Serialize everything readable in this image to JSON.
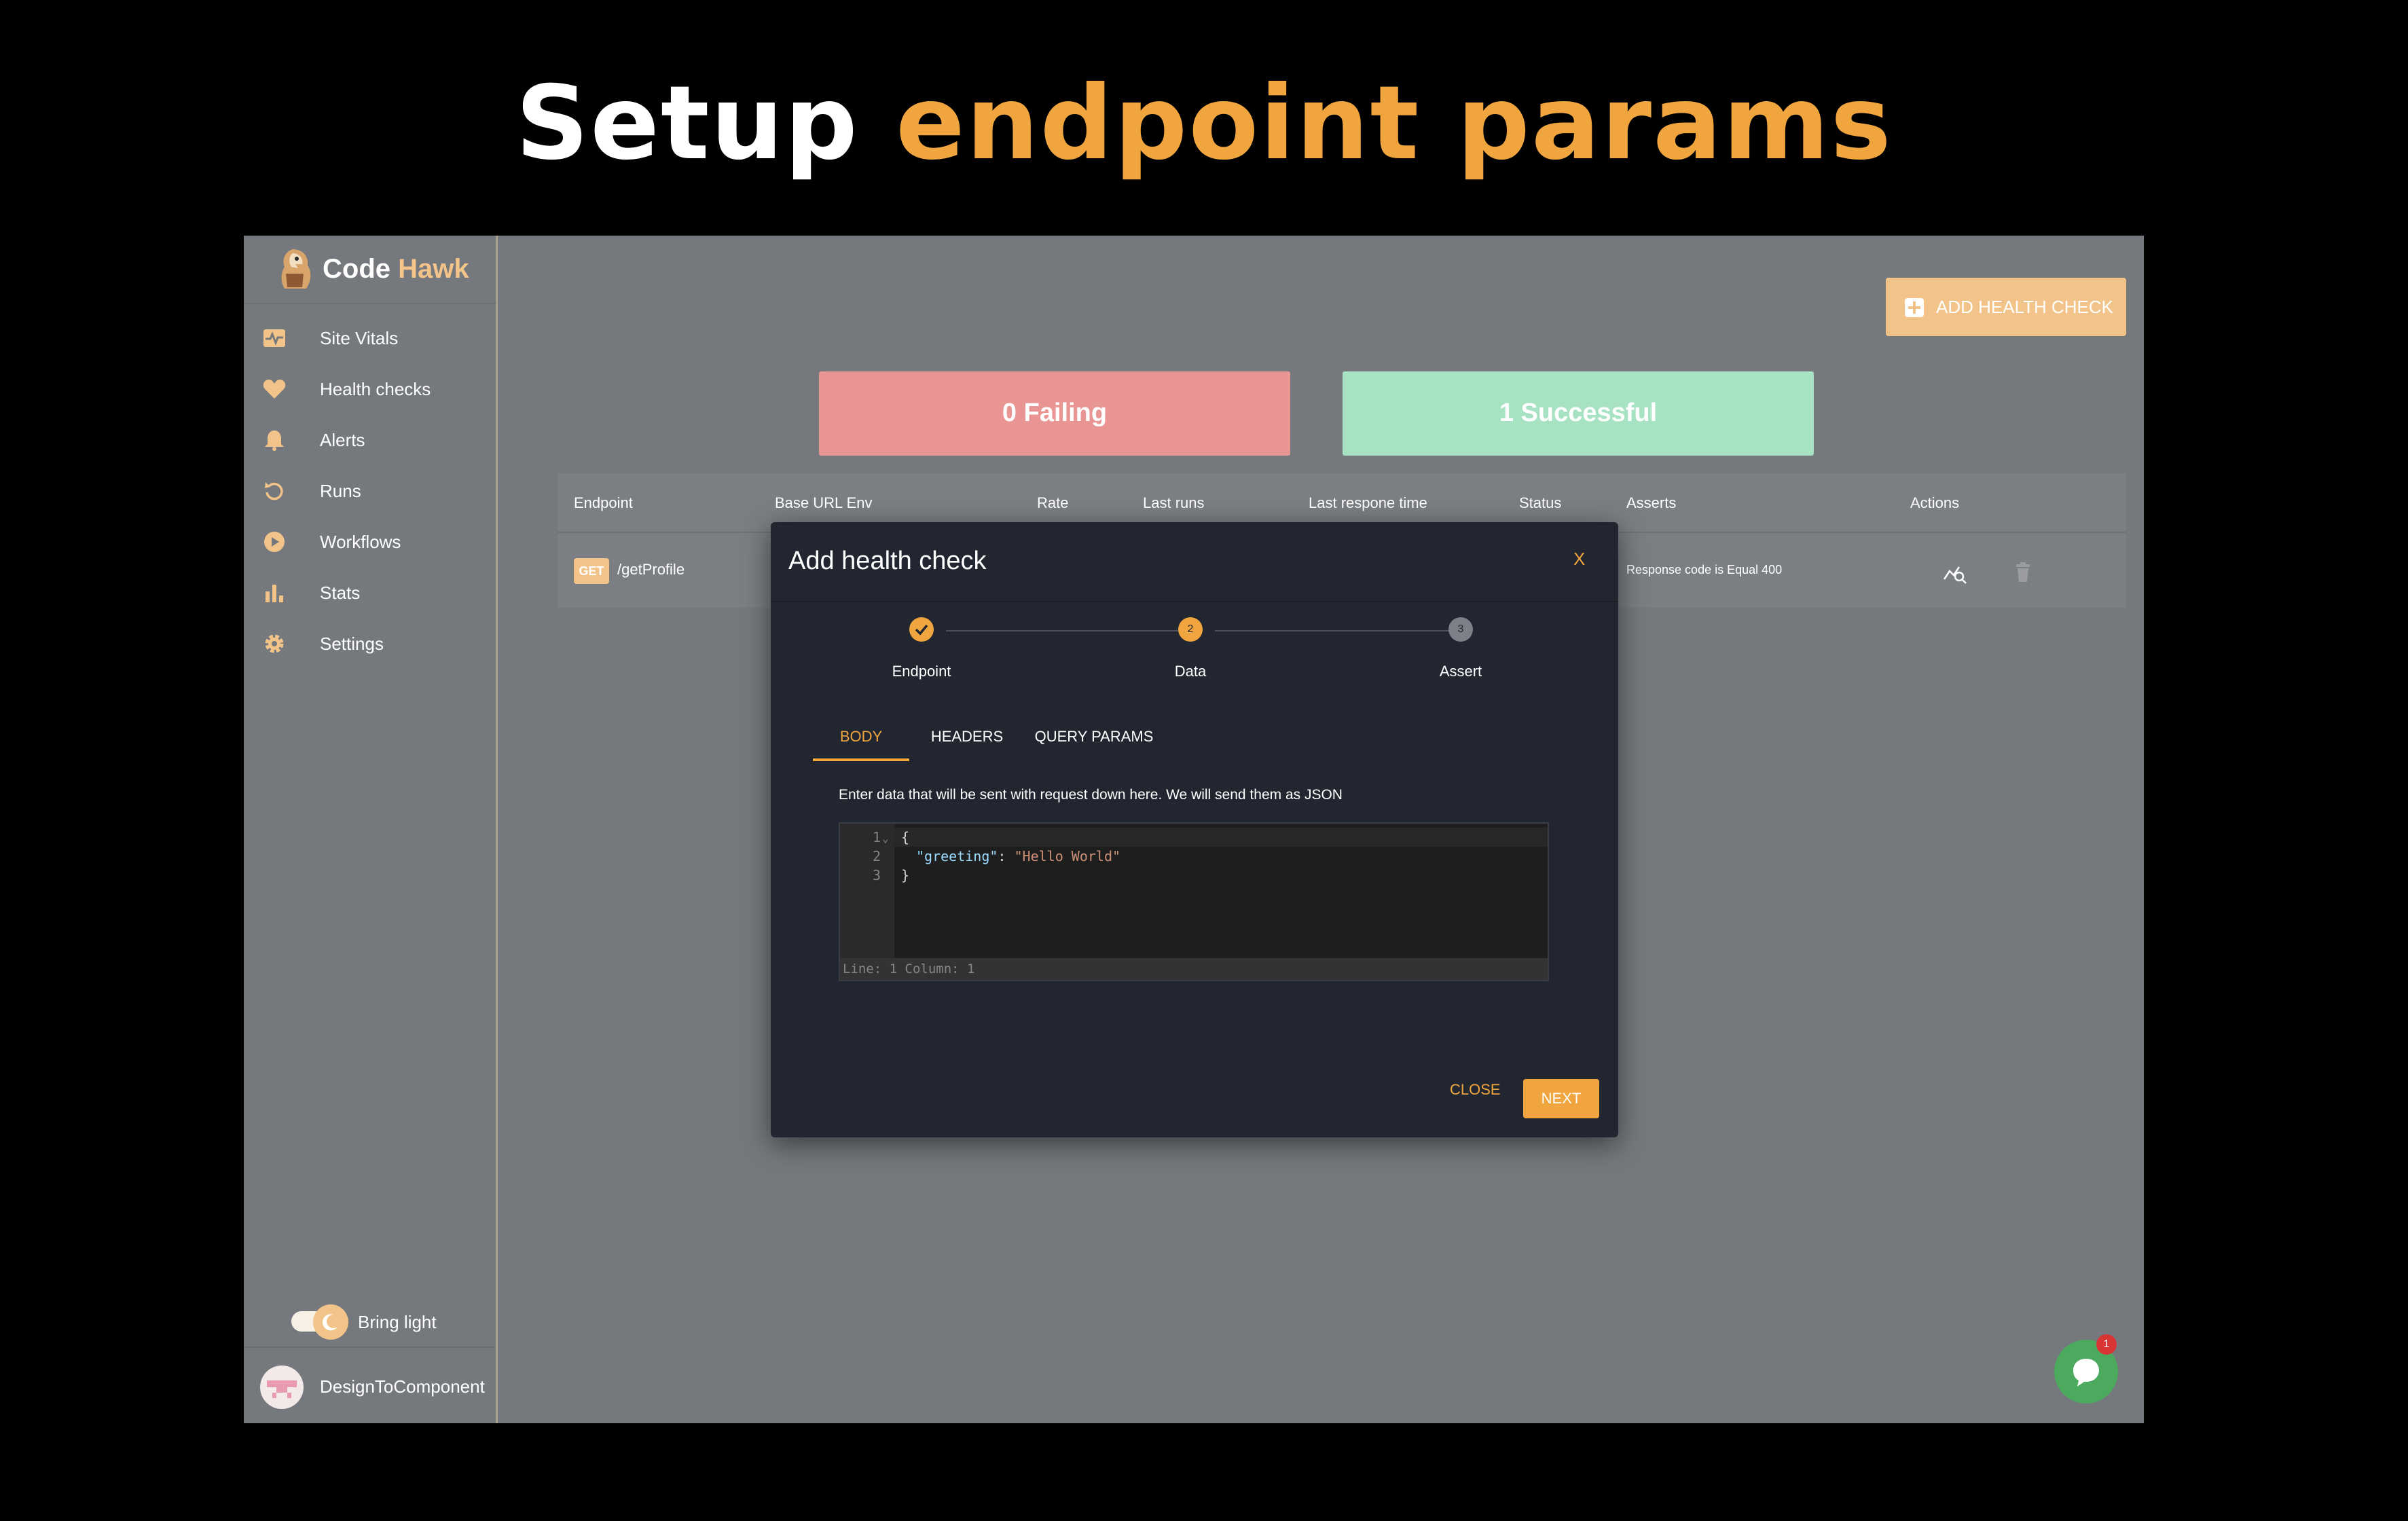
{
  "headline": {
    "white": "Setup",
    "orange": "endpoint params"
  },
  "brand": {
    "part1": "Code",
    "part2": "Hawk"
  },
  "sidebar": {
    "items": [
      {
        "label": "Site Vitals",
        "icon": "pulse-icon"
      },
      {
        "label": "Health checks",
        "icon": "heart-icon"
      },
      {
        "label": "Alerts",
        "icon": "bell-icon"
      },
      {
        "label": "Runs",
        "icon": "refresh-icon"
      },
      {
        "label": "Workflows",
        "icon": "play-circle-icon"
      },
      {
        "label": "Stats",
        "icon": "bar-chart-icon"
      },
      {
        "label": "Settings",
        "icon": "gear-icon"
      }
    ],
    "toggle_label": "Bring light",
    "user_name": "DesignToComponent"
  },
  "main": {
    "add_button": "ADD HEALTH CHECK",
    "failing": "0 Failing",
    "successful": "1 Successful",
    "table": {
      "headers": [
        "Endpoint",
        "Base URL Env",
        "Rate",
        "Last runs",
        "Last respone time",
        "Status",
        "Asserts",
        "Actions"
      ],
      "rows": [
        {
          "method": "GET",
          "endpoint": "/getProfile",
          "asserts": "Response code is Equal 400"
        }
      ]
    }
  },
  "modal": {
    "title": "Add health check",
    "close_x": "X",
    "steps": [
      {
        "label": "Endpoint",
        "state": "done"
      },
      {
        "label": "Data",
        "num": "2",
        "state": "active"
      },
      {
        "label": "Assert",
        "num": "3",
        "state": "pending"
      }
    ],
    "tabs": [
      "BODY",
      "HEADERS",
      "QUERY PARAMS"
    ],
    "active_tab": "BODY",
    "hint": "Enter data that will be sent with request down here. We will send them as JSON",
    "editor": {
      "line_numbers": [
        "1",
        "2",
        "3"
      ],
      "line1": "{",
      "line2_key": "\"greeting\"",
      "line2_colon": ": ",
      "line2_value": "\"Hello World\"",
      "line3": "}",
      "status": "Line: 1  Column: 1"
    },
    "close_button": "CLOSE",
    "next_button": "NEXT"
  },
  "chat": {
    "badge": "1"
  },
  "colors": {
    "accent": "#f0a53f",
    "brand_light": "#f2c48a",
    "failing": "#e89594",
    "success": "#a7e2c2",
    "modal_bg": "#222630",
    "app_bg": "#75787c"
  }
}
